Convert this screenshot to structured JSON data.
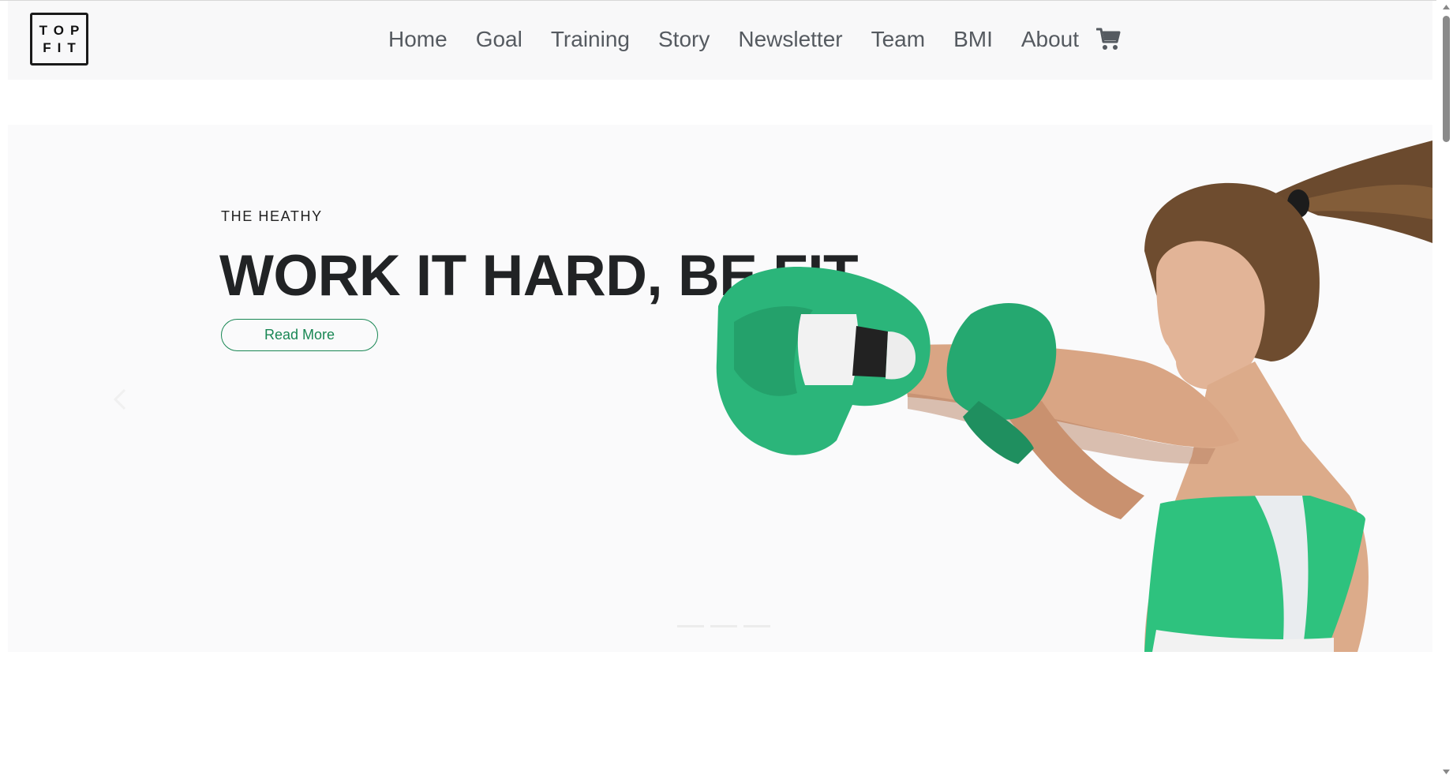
{
  "brand": {
    "logo_line1": "TOP",
    "logo_line2": "FIT"
  },
  "nav": {
    "items": [
      {
        "label": "Home"
      },
      {
        "label": "Goal"
      },
      {
        "label": "Training"
      },
      {
        "label": "Story"
      },
      {
        "label": "Newsletter"
      },
      {
        "label": "Team"
      },
      {
        "label": "BMI"
      },
      {
        "label": "About"
      }
    ],
    "cart_icon": "shopping-cart-icon"
  },
  "hero": {
    "eyebrow": "THE HEATHY",
    "headline": "WORK IT HARD, BE FIT",
    "cta_label": "Read More",
    "prev_icon": "chevron-left-icon",
    "slides_count": 3,
    "active_slide": 2
  },
  "colors": {
    "accent": "#198754",
    "header_bg": "#f8f8f9",
    "hero_bg": "#fafafb",
    "nav_text": "#555a60",
    "headline": "#212325"
  }
}
